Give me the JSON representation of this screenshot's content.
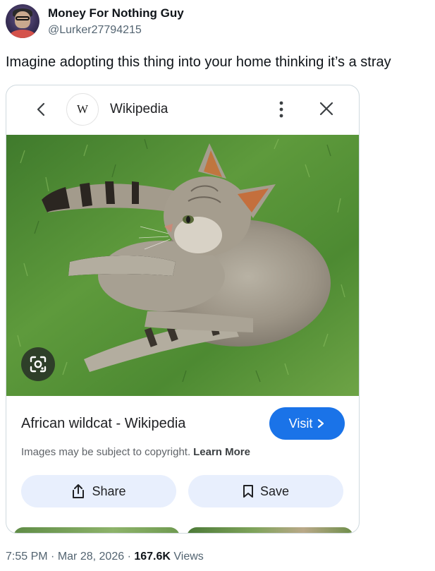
{
  "author": {
    "display_name": "Money For Nothing Guy",
    "handle": "@Lurker27794215"
  },
  "tweet": {
    "text": "Imagine adopting this thing into your home thinking it’s a stray"
  },
  "card": {
    "site_logo_letter": "W",
    "site_name": "Wikipedia",
    "result_title": "African wildcat - Wikipedia",
    "visit_label": "Visit",
    "copyright_text": "Images may be subject to copyright.",
    "learn_more_label": "Learn More",
    "share_label": "Share",
    "save_label": "Save",
    "accent_color": "#1a73e8",
    "icons": [
      "chevron-left-icon",
      "more-vert-icon",
      "close-icon",
      "google-lens-icon",
      "share-icon",
      "bookmark-icon",
      "chevron-right-icon"
    ]
  },
  "footer": {
    "time": "7:55 PM",
    "separator": "·",
    "date": "Mar 28, 2026",
    "views_count": "167.6K",
    "views_label": "Views"
  }
}
